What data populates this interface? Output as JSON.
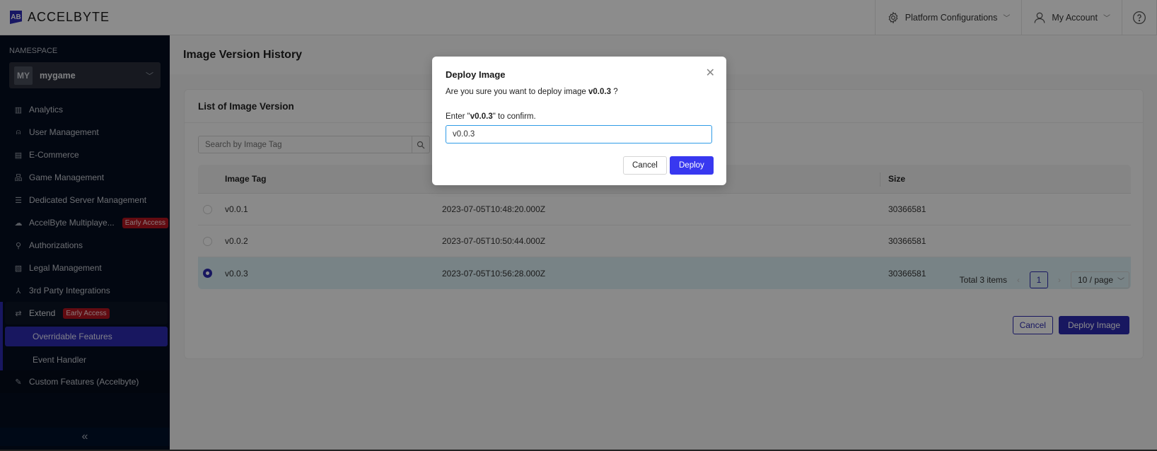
{
  "header": {
    "logo_text": "ACCELBYTE",
    "platform_config": "Platform Configurations",
    "my_account": "My Account"
  },
  "sidebar": {
    "namespace_label": "NAMESPACE",
    "namespace_avatar": "MY",
    "namespace_name": "mygame",
    "items": [
      {
        "label": "Analytics",
        "icon": "chart-icon"
      },
      {
        "label": "User Management",
        "icon": "user-icon"
      },
      {
        "label": "E-Commerce",
        "icon": "store-icon"
      },
      {
        "label": "Game Management",
        "icon": "hierarchy-icon"
      },
      {
        "label": "Dedicated Server Management",
        "icon": "server-icon"
      },
      {
        "label": "AccelByte Multiplaye...",
        "icon": "cloud-icon",
        "badge": "Early Access"
      },
      {
        "label": "Authorizations",
        "icon": "key-icon"
      },
      {
        "label": "Legal Management",
        "icon": "legal-doc-icon"
      },
      {
        "label": "3rd Party Integrations",
        "icon": "integration-icon"
      }
    ],
    "extend": {
      "label": "Extend",
      "badge": "Early Access",
      "sub_items": [
        "Overridable Features",
        "Event Handler"
      ]
    },
    "custom_features": "Custom Features (Accelbyte)",
    "collapse_glyph": "«"
  },
  "main": {
    "page_title": "Image Version History",
    "card_title": "List of Image Version",
    "search_placeholder": "Search by Image Tag",
    "columns": [
      "Image Tag",
      "Size"
    ],
    "rows": [
      {
        "tag": "v0.0.1",
        "created": "2023-07-05T10:48:20.000Z",
        "size": "30366581",
        "selected": false
      },
      {
        "tag": "v0.0.2",
        "created": "2023-07-05T10:50:44.000Z",
        "size": "30366581",
        "selected": false
      },
      {
        "tag": "v0.0.3",
        "created": "2023-07-05T10:56:28.000Z",
        "size": "30366581",
        "selected": true
      }
    ],
    "pagination": {
      "total": "Total 3 items",
      "current_page": "1",
      "page_size": "10 / page"
    },
    "cancel_label": "Cancel",
    "deploy_label": "Deploy Image"
  },
  "modal": {
    "title": "Deploy Image",
    "message_prefix": "Are you sure you want to deploy image ",
    "message_tag": "v0.0.3",
    "message_suffix": " ?",
    "hint_prefix": "Enter \"",
    "hint_tag": "v0.0.3",
    "hint_suffix": "\" to confirm.",
    "input_value": "v0.0.3",
    "cancel_label": "Cancel",
    "deploy_label": "Deploy"
  },
  "colors": {
    "brand": "#2c2ab0",
    "modal_primary": "#3838f0",
    "badge": "#b3141f",
    "sidebar_bg": "#050d1f"
  }
}
